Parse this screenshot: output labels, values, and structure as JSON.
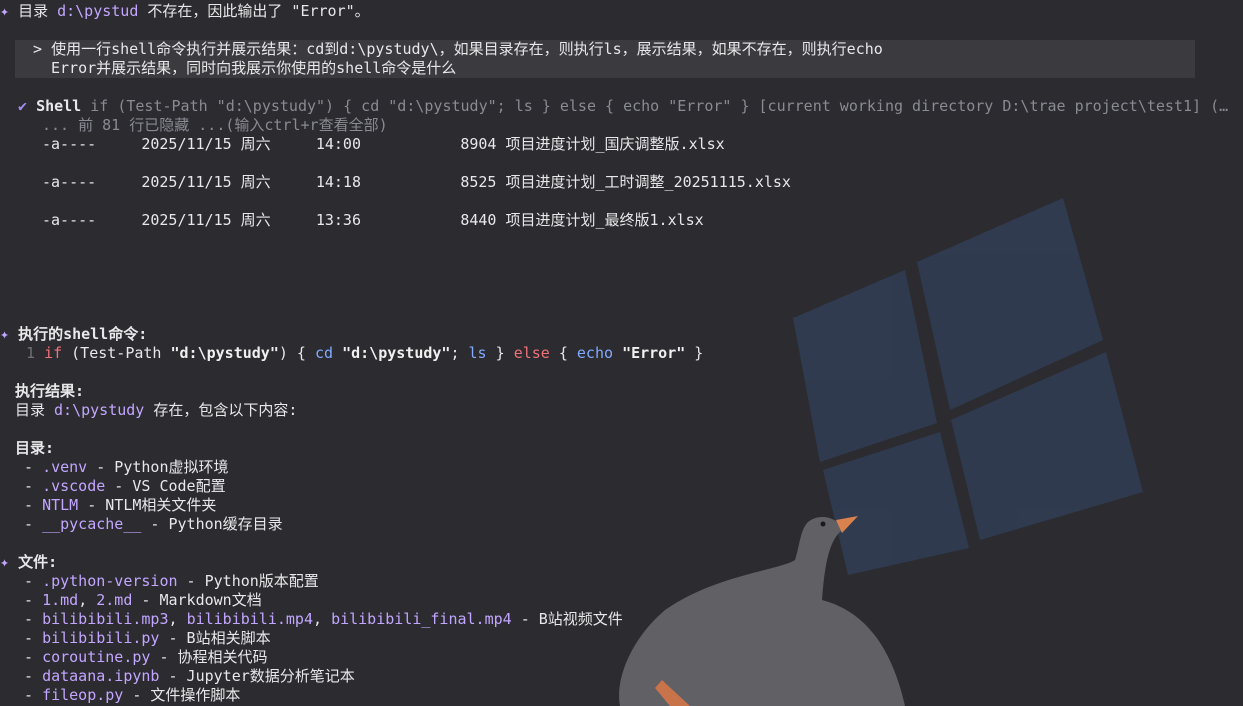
{
  "intro": {
    "marker": "✦",
    "before": "目录 ",
    "path": "d:\\pystud",
    "after": " 不存在，因此输出了 \"Error\"。"
  },
  "prompt": {
    "arrow": ">",
    "line1": "使用一行shell命令执行并展示结果：cd到d:\\pystudy\\，如果目录存在，则执行ls，展示结果，如果不存在，则执行echo",
    "line2": "Error并展示结果，同时向我展示你使用的shell命令是什么"
  },
  "shell": {
    "check": "✔",
    "label": "Shell",
    "command": "if (Test-Path \"d:\\pystudy\") { cd \"d:\\pystudy\"; ls } else { echo \"Error\" } [current working directory D:\\trae project\\test1] (…",
    "hidden": "... 前 81 行已隐藏 ...(输入ctrl+r查看全部)",
    "rows": [
      {
        "mode": "-a----",
        "date": "2025/11/15 周六",
        "time": "14:00",
        "size": "8904",
        "name": "项目进度计划_国庆调整版.xlsx"
      },
      {
        "mode": "-a----",
        "date": "2025/11/15 周六",
        "time": "14:18",
        "size": "8525",
        "name": "项目进度计划_工时调整_20251115.xlsx"
      },
      {
        "mode": "-a----",
        "date": "2025/11/15 周六",
        "time": "13:36",
        "size": "8440",
        "name": "项目进度计划_最终版1.xlsx"
      }
    ]
  },
  "answer": {
    "marker": "✦",
    "heading": "执行的shell命令:",
    "code": {
      "lineno": "1",
      "t1": "if",
      "t2": " (Test-Path ",
      "t3": "\"d:\\pystudy\"",
      "t4": ") { ",
      "t5": "cd",
      "t6": " ",
      "t7": "\"d:\\pystudy\"",
      "t8": "; ",
      "t9": "ls",
      "t10": " } ",
      "t11": "else",
      "t12": " { ",
      "t13": "echo",
      "t14": " ",
      "t15": "\"Error\"",
      "t16": " }"
    },
    "result_heading": "执行结果:",
    "result_before": "目录 ",
    "result_path": "d:\\pystudy",
    "result_after": " 存在，包含以下内容:",
    "dirs_heading": "目录:",
    "dirs": [
      {
        "name": ".venv",
        "desc": " - Python虚拟环境"
      },
      {
        "name": ".vscode",
        "desc": " - VS Code配置"
      },
      {
        "name": "NTLM",
        "desc": " - NTLM相关文件夹"
      },
      {
        "name": "__pycache__",
        "desc": " - Python缓存目录"
      }
    ],
    "files_marker": "✦",
    "files_heading": "文件:",
    "files": [
      {
        "names": [
          ".python-version"
        ],
        "desc": " - Python版本配置"
      },
      {
        "names": [
          "1.md",
          "2.md"
        ],
        "desc": " - Markdown文档"
      },
      {
        "names": [
          "bilibibili.mp3",
          "bilibibili.mp4",
          "bilibibili_final.mp4"
        ],
        "desc": " - B站视频文件"
      },
      {
        "names": [
          "bilibibili.py"
        ],
        "desc": " - B站相关脚本"
      },
      {
        "names": [
          "coroutine.py"
        ],
        "desc": " - 协程相关代码"
      },
      {
        "names": [
          "dataana.ipynb"
        ],
        "desc": " - Jupyter数据分析笔记本"
      },
      {
        "names": [
          "fileop.py"
        ],
        "desc": " - 文件操作脚本"
      }
    ]
  },
  "colors": {
    "background": "#2b2b30",
    "accent": "#c3a6ff",
    "keyword": "#f07178",
    "command": "#82aaff",
    "muted": "#8a8a92"
  }
}
